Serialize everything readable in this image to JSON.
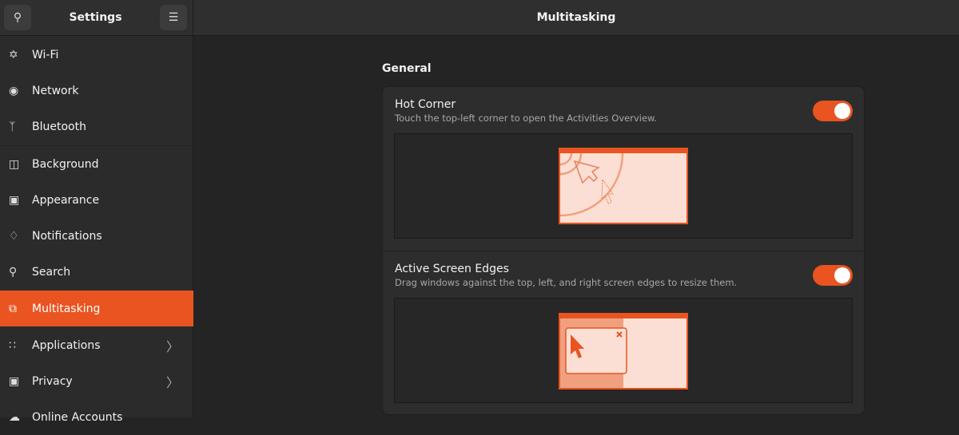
{
  "sidebar": {
    "title": "Settings",
    "items": [
      {
        "label": "Wi-Fi",
        "icon": "wifi-icon"
      },
      {
        "label": "Network",
        "icon": "globe-icon"
      },
      {
        "label": "Bluetooth",
        "icon": "bluetooth-icon"
      },
      {
        "label": "Background",
        "icon": "monitor-icon"
      },
      {
        "label": "Appearance",
        "icon": "appearance-icon"
      },
      {
        "label": "Notifications",
        "icon": "bell-icon"
      },
      {
        "label": "Search",
        "icon": "search-icon"
      },
      {
        "label": "Multitasking",
        "icon": "multitasking-icon"
      },
      {
        "label": "Applications",
        "icon": "grid-icon"
      },
      {
        "label": "Privacy",
        "icon": "lock-icon"
      },
      {
        "label": "Online Accounts",
        "icon": "cloud-icon"
      }
    ]
  },
  "header": {
    "title": "Multitasking"
  },
  "section": "General",
  "hot_corner": {
    "title": "Hot Corner",
    "description": "Touch the top-left corner to open the Activities Overview.",
    "enabled": true
  },
  "screen_edges": {
    "title": "Active Screen Edges",
    "description": "Drag windows against the top, left, and right screen edges to resize them.",
    "enabled": true
  },
  "colors": {
    "accent": "#e95420"
  }
}
